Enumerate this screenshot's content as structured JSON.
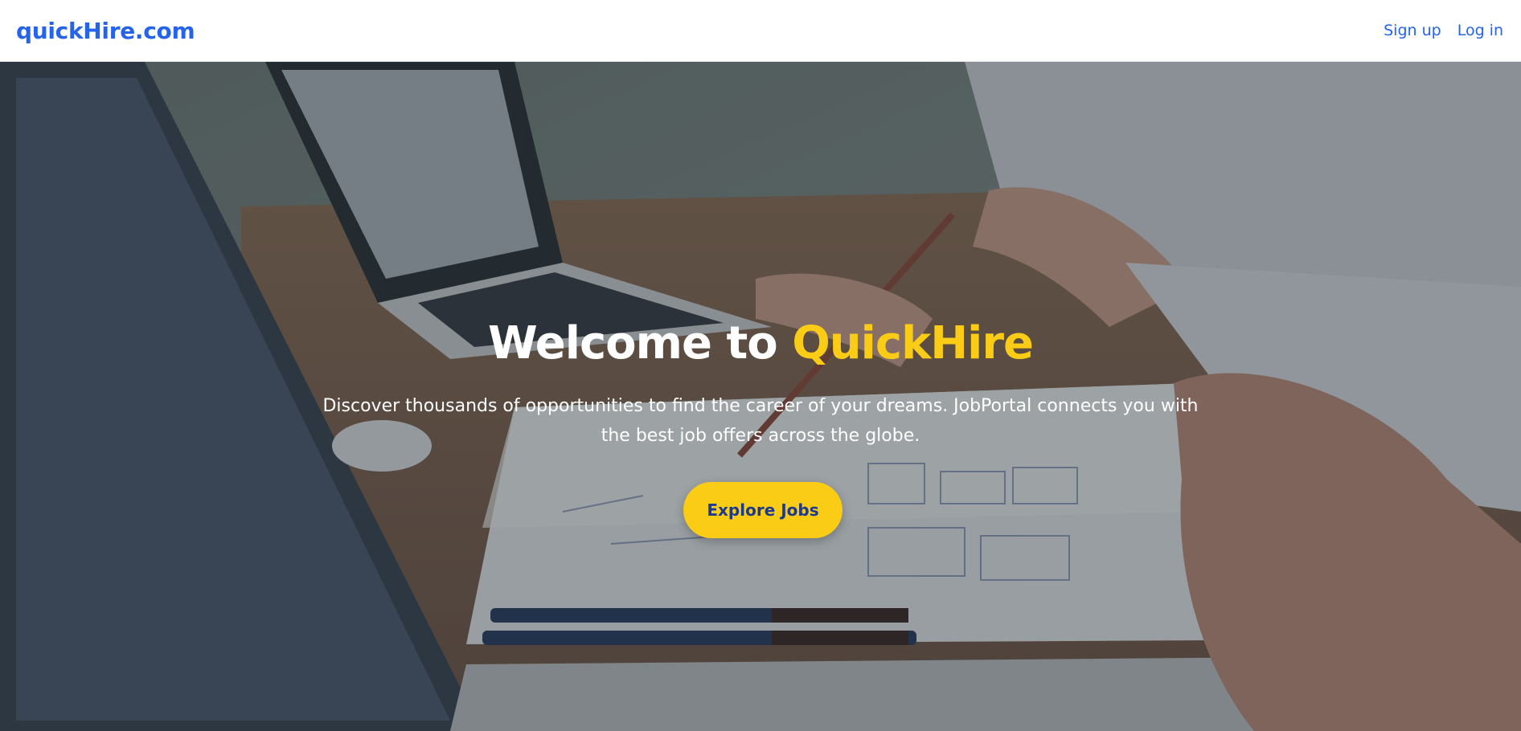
{
  "header": {
    "brand": "quickHire.com",
    "nav": [
      {
        "label": "Sign up"
      },
      {
        "label": "Log in"
      }
    ]
  },
  "hero": {
    "title_prefix": "Welcome to ",
    "title_accent": "QuickHire",
    "subtitle": "Discover thousands of opportunities to find the career of your dreams. JobPortal connects you with the best job offers across the globe.",
    "cta_label": "Explore Jobs",
    "background_image": "office-desk-laptops-hands-photo"
  },
  "colors": {
    "brand": "#2563eb",
    "accent": "#facc15",
    "cta_text": "#1e3a8a"
  }
}
